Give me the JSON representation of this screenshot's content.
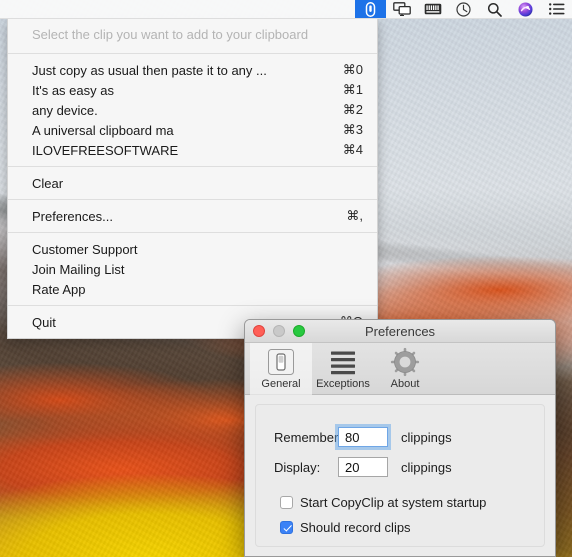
{
  "menubar": {
    "icons": [
      {
        "name": "paperclip-icon",
        "label": "CopyClip",
        "active": true
      },
      {
        "name": "screen-sharing-icon",
        "label": "Display",
        "active": false
      },
      {
        "name": "keyboard-icon",
        "label": "Keyboard",
        "active": false
      },
      {
        "name": "clock-icon",
        "label": "Time Machine",
        "active": false
      },
      {
        "name": "search-icon",
        "label": "Spotlight",
        "active": false
      },
      {
        "name": "siri-icon",
        "label": "Siri",
        "active": false
      },
      {
        "name": "list-icon",
        "label": "Notification Center",
        "active": false
      }
    ],
    "accent": "#1d72e8"
  },
  "menu": {
    "header": "Select the clip you want to add to your clipboard",
    "clips": [
      {
        "label": "Just copy as usual then paste it to any ...",
        "shortcut": "⌘0"
      },
      {
        "label": "It's as easy as",
        "shortcut": "⌘1"
      },
      {
        "label": "any device.",
        "shortcut": "⌘2"
      },
      {
        "label": "A universal clipboard ma",
        "shortcut": "⌘3"
      },
      {
        "label": "ILOVEFREESOFTWARE",
        "shortcut": "⌘4"
      }
    ],
    "clear": {
      "label": "Clear",
      "shortcut": ""
    },
    "preferences": {
      "label": "Preferences...",
      "shortcut": "⌘,"
    },
    "links": [
      {
        "label": "Customer Support",
        "shortcut": ""
      },
      {
        "label": "Join Mailing List",
        "shortcut": ""
      },
      {
        "label": "Rate App",
        "shortcut": ""
      }
    ],
    "quit": {
      "label": "Quit",
      "shortcut": "⌘Q"
    }
  },
  "preferences": {
    "title": "Preferences",
    "toolbar": [
      {
        "label": "General",
        "icon": "switch-icon",
        "selected": true
      },
      {
        "label": "Exceptions",
        "icon": "lines-icon",
        "selected": false
      },
      {
        "label": "About",
        "icon": "gear-icon",
        "selected": false
      }
    ],
    "general": {
      "remember_label": "Remember:",
      "remember_value": "80",
      "remember_suffix": "clippings",
      "display_label": "Display:",
      "display_value": "20",
      "display_suffix": "clippings",
      "startup_checkbox": {
        "label": "Start CopyClip at system startup",
        "checked": false
      },
      "record_checkbox": {
        "label": "Should record clips",
        "checked": true
      }
    },
    "focus_color": "#5aa0e8",
    "check_color": "#3b82f6"
  }
}
